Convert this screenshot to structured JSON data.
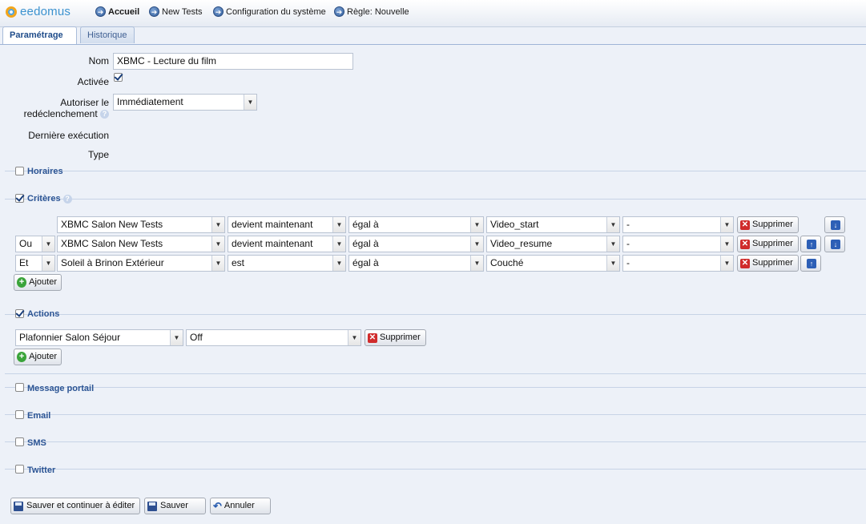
{
  "brand": {
    "name": "eedomus"
  },
  "nav": [
    {
      "label": "Accueil"
    },
    {
      "label": "New Tests"
    },
    {
      "label": "Configuration du système"
    },
    {
      "label": "Règle: Nouvelle"
    }
  ],
  "tabs": [
    {
      "label": "Paramétrage"
    },
    {
      "label": "Historique"
    }
  ],
  "form": {
    "nom_label": "Nom",
    "nom_value": "XBMC - Lecture du film",
    "activee_label": "Activée",
    "autoriser_label_1": "Autoriser le",
    "autoriser_label_2": "redéclenchement",
    "autoriser_value": "Immédiatement",
    "derniere_label": "Dernière exécution",
    "type_label": "Type"
  },
  "sections": {
    "horaires": "Horaires",
    "criteres": "Critères",
    "actions": "Actions",
    "message_portail": "Message portail",
    "email": "Email",
    "sms": "SMS",
    "twitter": "Twitter"
  },
  "criteria": [
    {
      "connector": "",
      "device": "XBMC Salon New Tests",
      "condition": "devient maintenant",
      "operator": "égal à",
      "value": "Video_start",
      "extra": "-",
      "delete": "Supprimer"
    },
    {
      "connector": "Ou",
      "device": "XBMC Salon New Tests",
      "condition": "devient maintenant",
      "operator": "égal à",
      "value": "Video_resume",
      "extra": "-",
      "delete": "Supprimer"
    },
    {
      "connector": "Et",
      "device": "Soleil à Brinon Extérieur",
      "condition": "est",
      "operator": "égal à",
      "value": "Couché",
      "extra": "-",
      "delete": "Supprimer"
    }
  ],
  "criteria_add": "Ajouter",
  "action_rows": [
    {
      "device": "Plafonnier Salon Séjour",
      "value": "Off",
      "delete": "Supprimer"
    }
  ],
  "actions_add": "Ajouter",
  "footer": {
    "save_continue": "Sauver et continuer à éditer",
    "save": "Sauver",
    "cancel": "Annuler"
  }
}
